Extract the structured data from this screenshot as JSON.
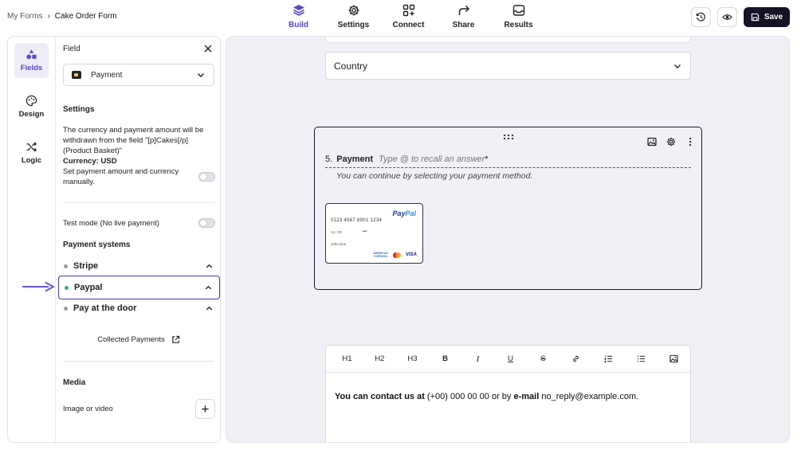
{
  "breadcrumb": {
    "root": "My Forms",
    "separator": "›",
    "current": "Cake Order Form"
  },
  "nav": [
    {
      "label": "Build",
      "icon": "layers-icon",
      "active": true
    },
    {
      "label": "Settings",
      "icon": "gear-icon",
      "active": false
    },
    {
      "label": "Connect",
      "icon": "connect-icon",
      "active": false
    },
    {
      "label": "Share",
      "icon": "share-icon",
      "active": false
    },
    {
      "label": "Results",
      "icon": "inbox-icon",
      "active": false
    }
  ],
  "actions": {
    "save_label": "Save"
  },
  "rail": [
    {
      "label": "Fields",
      "icon": "shapes-icon"
    },
    {
      "label": "Design",
      "icon": "palette-icon"
    },
    {
      "label": "Logic",
      "icon": "shuffle-icon"
    }
  ],
  "field_panel": {
    "header": "Field",
    "selected_field": "Payment",
    "settings_title": "Settings",
    "description": "The currency and payment amount will be withdrawn from the field \"[p]Cakes[/p] (Product Basket)\"",
    "currency": "Currency: USD",
    "manual_label": "Set payment amount and currency manually.",
    "test_mode_label": "Test mode (No live payment)",
    "payment_systems_title": "Payment systems",
    "payment_systems": [
      "Stripe",
      "Paypal",
      "Pay at the door"
    ],
    "collected_payments": "Collected Payments",
    "media_title": "Media",
    "media_label": "Image or video"
  },
  "canvas": {
    "country_label": "Country",
    "question": {
      "number": "5.",
      "title": "Payment",
      "placeholder": "Type @ to recall an answer",
      "required_mark": "*",
      "subtitle": "You can continue by selecting your payment method."
    },
    "paypal_card": {
      "logo_part1": "Pay",
      "logo_part2": "Pal",
      "number": "0123 4567 8901 1234",
      "expiry": "12 / 28",
      "cvv": "•••",
      "name": "John Doe",
      "amex_line1": "AMERICAN",
      "amex_line2": "EXPRESS",
      "visa": "VISA"
    },
    "editor": {
      "toolbar": [
        "H1",
        "H2",
        "H3",
        "B",
        "I",
        "U",
        "S"
      ],
      "text_bold1": "You can contact us at",
      "text_plain1": " (+00) 000 00 00 or by ",
      "text_bold2": "e-mail",
      "text_plain2": " no_reply@example.com."
    }
  },
  "colors": {
    "accent": "#5b45c7",
    "dark": "#141426",
    "canvas_bg": "#f0f0f6",
    "selected_border": "#3d3ab8",
    "active_dot": "#2bb673"
  }
}
